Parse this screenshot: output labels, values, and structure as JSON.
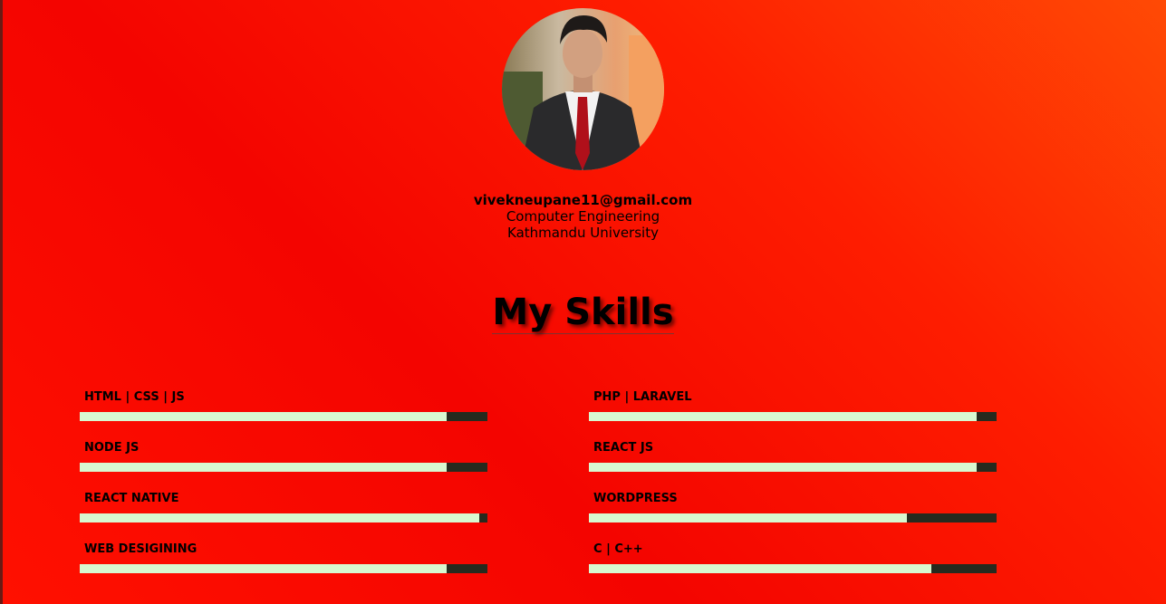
{
  "profile": {
    "email": "vivekneupane11@gmail.com",
    "program": "Computer Engineering",
    "university": "Kathmandu University"
  },
  "skills_heading": "My Skills",
  "colors": {
    "bar_fill": "#d8f8d0",
    "bar_track": "#262a1e",
    "background_start": "#ff4a05",
    "background_end": "#f40400"
  },
  "skills": [
    {
      "label": "HTML | CSS | JS",
      "level": 0.9
    },
    {
      "label": "PHP | LARAVEL",
      "level": 0.95
    },
    {
      "label": "NODE JS",
      "level": 0.9
    },
    {
      "label": "REACT JS",
      "level": 0.95
    },
    {
      "label": "REACT NATIVE",
      "level": 0.98
    },
    {
      "label": "WORDPRESS",
      "level": 0.78
    },
    {
      "label": "WEB DESIGINING",
      "level": 0.9
    },
    {
      "label": "C | C++",
      "level": 0.84
    }
  ]
}
